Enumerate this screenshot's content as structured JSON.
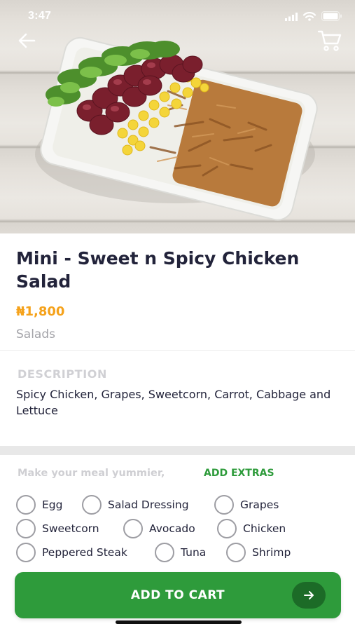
{
  "status_bar": {
    "time": "3:47"
  },
  "header": {
    "back_icon": "arrow-left-icon",
    "cart_icon": "shopping-cart-icon"
  },
  "product": {
    "title": "Mini - Sweet n Spicy Chicken Salad",
    "price": "₦1,800",
    "category": "Salads",
    "description_label": "DESCRIPTION",
    "description": "Spicy Chicken, Grapes, Sweetcorn, Carrot, Cabbage and Lettuce"
  },
  "extras": {
    "prompt": "Make your meal yummier,",
    "link_label": "ADD EXTRAS",
    "options": [
      {
        "label": "Egg",
        "checked": false
      },
      {
        "label": "Salad Dressing",
        "checked": false
      },
      {
        "label": "Grapes",
        "checked": false
      },
      {
        "label": "Sweetcorn",
        "checked": false
      },
      {
        "label": "Avocado",
        "checked": false
      },
      {
        "label": "Chicken",
        "checked": false
      },
      {
        "label": "Peppered Steak",
        "checked": false
      },
      {
        "label": "Tuna",
        "checked": false
      },
      {
        "label": "Shrimp",
        "checked": false
      }
    ]
  },
  "cta": {
    "label": "ADD TO CART",
    "icon": "arrow-right-icon"
  },
  "colors": {
    "accent_green": "#2e9b3b",
    "price_orange": "#f5a21b",
    "text_dark": "#22233a"
  }
}
